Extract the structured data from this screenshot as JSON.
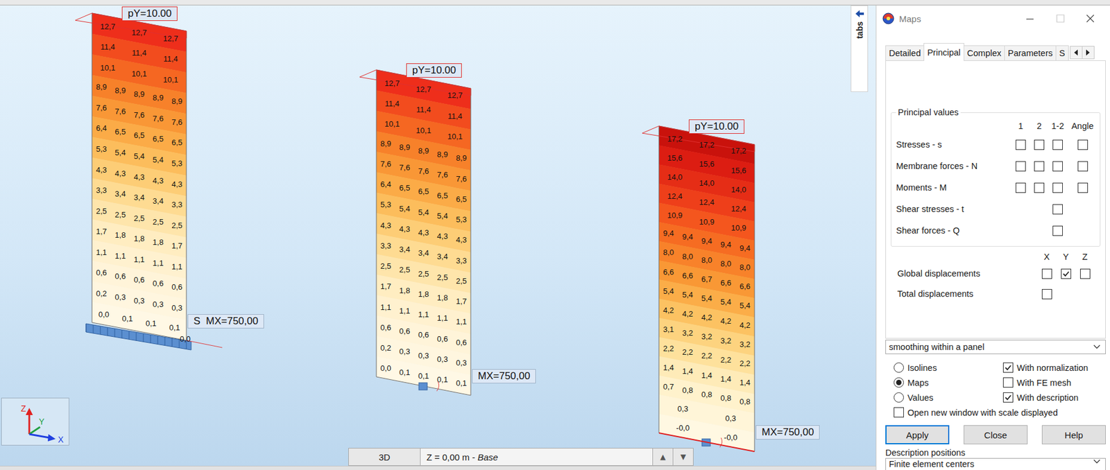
{
  "viewport": {
    "panels": [
      {
        "load_label": "pY=10.00",
        "moment_label": "S  MX=750,00",
        "corner_label": "0,0",
        "rows": [
          {
            "values": [
              "12,7",
              "12,7",
              "12,7"
            ],
            "color": "#ee2e1b"
          },
          {
            "values": [
              "11,4",
              "11,4",
              "11,4"
            ],
            "color": "#f24c1e"
          },
          {
            "values": [
              "10,1",
              "10,1",
              "10,1"
            ],
            "color": "#f56722"
          },
          {
            "values": [
              "8,9",
              "8,9",
              "8,9",
              "8,9",
              "8,9"
            ],
            "color": "#f7812a"
          },
          {
            "values": [
              "7,6",
              "7,6",
              "7,6",
              "7,6",
              "7,6"
            ],
            "color": "#f99736"
          },
          {
            "values": [
              "6,4",
              "6,5",
              "6,5",
              "6,5",
              "6,5"
            ],
            "color": "#fbab47"
          },
          {
            "values": [
              "5,3",
              "5,4",
              "5,4",
              "5,4",
              "5,3"
            ],
            "color": "#fcbd5c"
          },
          {
            "values": [
              "4,3",
              "4,3",
              "4,3",
              "4,3",
              "4,3"
            ],
            "color": "#fdcd76"
          },
          {
            "values": [
              "3,3",
              "3,4",
              "3,4",
              "3,4",
              "3,3"
            ],
            "color": "#fedb92"
          },
          {
            "values": [
              "2,5",
              "2,5",
              "2,5",
              "2,5",
              "2,5"
            ],
            "color": "#fee5ab"
          },
          {
            "values": [
              "1,7",
              "1,8",
              "1,8",
              "1,8",
              "1,7"
            ],
            "color": "#ffedc1"
          },
          {
            "values": [
              "1,1",
              "1,1",
              "1,1",
              "1,1",
              "1,1"
            ],
            "color": "#fff1cf"
          },
          {
            "values": [
              "0,6",
              "0,6",
              "0,6",
              "0,6",
              "0,6"
            ],
            "color": "#fff4d9"
          },
          {
            "values": [
              "0,2",
              "0,3",
              "0,3",
              "0,3",
              "0,3"
            ],
            "color": "#fff6df"
          },
          {
            "values": [
              "0,0",
              "0,1",
              "0,1",
              "0,1"
            ],
            "color": "#fff8e5"
          }
        ]
      },
      {
        "load_label": "pY=10.00",
        "moment_label": "MX=750,00",
        "rows": [
          {
            "values": [
              "12,7",
              "12,7",
              "12,7"
            ],
            "color": "#ee2e1b"
          },
          {
            "values": [
              "11,4",
              "11,4",
              "11,4"
            ],
            "color": "#f24c1e"
          },
          {
            "values": [
              "10,1",
              "10,1",
              "10,1"
            ],
            "color": "#f56722"
          },
          {
            "values": [
              "8,9",
              "8,9",
              "8,9",
              "8,9",
              "8,9"
            ],
            "color": "#f7812a"
          },
          {
            "values": [
              "7,6",
              "7,6",
              "7,6",
              "7,6",
              "7,6"
            ],
            "color": "#f99736"
          },
          {
            "values": [
              "6,4",
              "6,5",
              "6,5",
              "6,5",
              "6,5"
            ],
            "color": "#fbab47"
          },
          {
            "values": [
              "5,3",
              "5,4",
              "5,4",
              "5,4",
              "5,3"
            ],
            "color": "#fcbd5c"
          },
          {
            "values": [
              "4,3",
              "4,3",
              "4,3",
              "4,3",
              "4,3"
            ],
            "color": "#fdcd76"
          },
          {
            "values": [
              "3,3",
              "3,4",
              "3,4",
              "3,4",
              "3,3"
            ],
            "color": "#fedb92"
          },
          {
            "values": [
              "2,5",
              "2,5",
              "2,5",
              "2,5",
              "2,5"
            ],
            "color": "#fee5ab"
          },
          {
            "values": [
              "1,7",
              "1,8",
              "1,8",
              "1,8",
              "1,7"
            ],
            "color": "#ffedc1"
          },
          {
            "values": [
              "1,1",
              "1,1",
              "1,1",
              "1,1",
              "1,1"
            ],
            "color": "#fff1cf"
          },
          {
            "values": [
              "0,6",
              "0,6",
              "0,6",
              "0,6",
              "0,6"
            ],
            "color": "#fff4d9"
          },
          {
            "values": [
              "0,2",
              "0,3",
              "0,3",
              "0,3",
              "0,3"
            ],
            "color": "#fff6df"
          },
          {
            "values": [
              "0,0",
              "0,1",
              "0,1",
              "0,1",
              "0,1"
            ],
            "color": "#fff8e5"
          }
        ]
      },
      {
        "load_label": "pY=10.00",
        "moment_label": "MX=750,00",
        "rows": [
          {
            "values": [
              "17,2",
              "17,2",
              "17,2"
            ],
            "color": "#c9120c"
          },
          {
            "values": [
              "15,6",
              "15,6",
              "15,6"
            ],
            "color": "#dc1d12"
          },
          {
            "values": [
              "14,0",
              "14,0",
              "14,0"
            ],
            "color": "#e52d16"
          },
          {
            "values": [
              "12,4",
              "12,4",
              "12,4"
            ],
            "color": "#ee3f1a"
          },
          {
            "values": [
              "10,9",
              "10,9",
              "10,9"
            ],
            "color": "#f4561e"
          },
          {
            "values": [
              "9,4",
              "9,4",
              "9,4",
              "9,4",
              "9,4"
            ],
            "color": "#f66c22"
          },
          {
            "values": [
              "8,0",
              "8,0",
              "8,0",
              "8,0",
              "8,0"
            ],
            "color": "#f8822a"
          },
          {
            "values": [
              "6,6",
              "6,6",
              "6,7",
              "6,6",
              "6,6"
            ],
            "color": "#f99835"
          },
          {
            "values": [
              "5,4",
              "5,4",
              "5,4",
              "5,4",
              "5,4"
            ],
            "color": "#fbad48"
          },
          {
            "values": [
              "4,2",
              "4,2",
              "4,2",
              "4,2",
              "4,2"
            ],
            "color": "#fcc262"
          },
          {
            "values": [
              "3,1",
              "3,2",
              "3,2",
              "3,2",
              "3,2"
            ],
            "color": "#fdd37f"
          },
          {
            "values": [
              "2,2",
              "2,2",
              "2,2",
              "2,2",
              "2,2"
            ],
            "color": "#fee19c"
          },
          {
            "values": [
              "1,4",
              "1,4",
              "1,4",
              "1,4",
              "1,4"
            ],
            "color": "#feebb8"
          },
          {
            "values": [
              "0,7",
              "0,8",
              "0,8",
              "0,8",
              "0,8"
            ],
            "color": "#fff2cc"
          },
          {
            "values": [
              "0,3",
              "0,3"
            ],
            "color": "#fff5d8"
          },
          {
            "values": [
              "-0,0",
              "-0,0"
            ],
            "color": "#fff8e2"
          }
        ]
      }
    ],
    "axes": {
      "z": "Z",
      "y": "Y",
      "x": "X"
    },
    "side_tab": {
      "label": "tabs"
    },
    "bottom_bar": {
      "view": "3D",
      "level_label": "Z = 0,00 m - ",
      "level_name": "Base",
      "up": "▲",
      "down": "▼"
    }
  },
  "window": {
    "title": "Maps"
  },
  "tabs": [
    {
      "label": "Detailed",
      "selected": false
    },
    {
      "label": "Principal",
      "selected": true
    },
    {
      "label": "Complex",
      "selected": false
    },
    {
      "label": "Parameters",
      "selected": false
    },
    {
      "label": "S",
      "selected": false
    }
  ],
  "principal_values": {
    "title": "Principal values",
    "columns": [
      "1",
      "2",
      "1-2",
      "Angle"
    ],
    "rows": [
      {
        "label": "Stresses - s",
        "kind": "four",
        "checks": [
          false,
          false,
          false,
          false
        ]
      },
      {
        "label": "Membrane forces - N",
        "kind": "four",
        "checks": [
          false,
          false,
          false,
          false
        ]
      },
      {
        "label": "Moments - M",
        "kind": "four",
        "checks": [
          false,
          false,
          false,
          false
        ]
      },
      {
        "label": "Shear stresses - t",
        "kind": "combined",
        "checks": [
          false
        ]
      },
      {
        "label": "Shear forces - Q",
        "kind": "combined",
        "checks": [
          false
        ]
      }
    ]
  },
  "displacements": {
    "columns": [
      "X",
      "Y",
      "Z"
    ],
    "rows": [
      {
        "label": "Global displacements",
        "kind": "xyz",
        "checks": [
          false,
          true,
          false
        ]
      },
      {
        "label": "Total displacements",
        "kind": "single",
        "checks": [
          false
        ]
      }
    ]
  },
  "smoothing": "smoothing within a panel",
  "display_mode": [
    {
      "label": "Isolines",
      "selected": false
    },
    {
      "label": "Maps",
      "selected": true
    },
    {
      "label": "Values",
      "selected": false
    }
  ],
  "options": [
    {
      "label": "With normalization",
      "checked": true
    },
    {
      "label": "With FE mesh",
      "checked": false
    },
    {
      "label": "With description",
      "checked": true
    },
    {
      "label": "Open new window with scale displayed",
      "checked": false
    }
  ],
  "buttons": [
    {
      "label": "Apply",
      "default": true
    },
    {
      "label": "Close",
      "default": false
    },
    {
      "label": "Help",
      "default": false
    }
  ],
  "description_positions": {
    "label": "Description positions",
    "value": "Finite element centers"
  }
}
